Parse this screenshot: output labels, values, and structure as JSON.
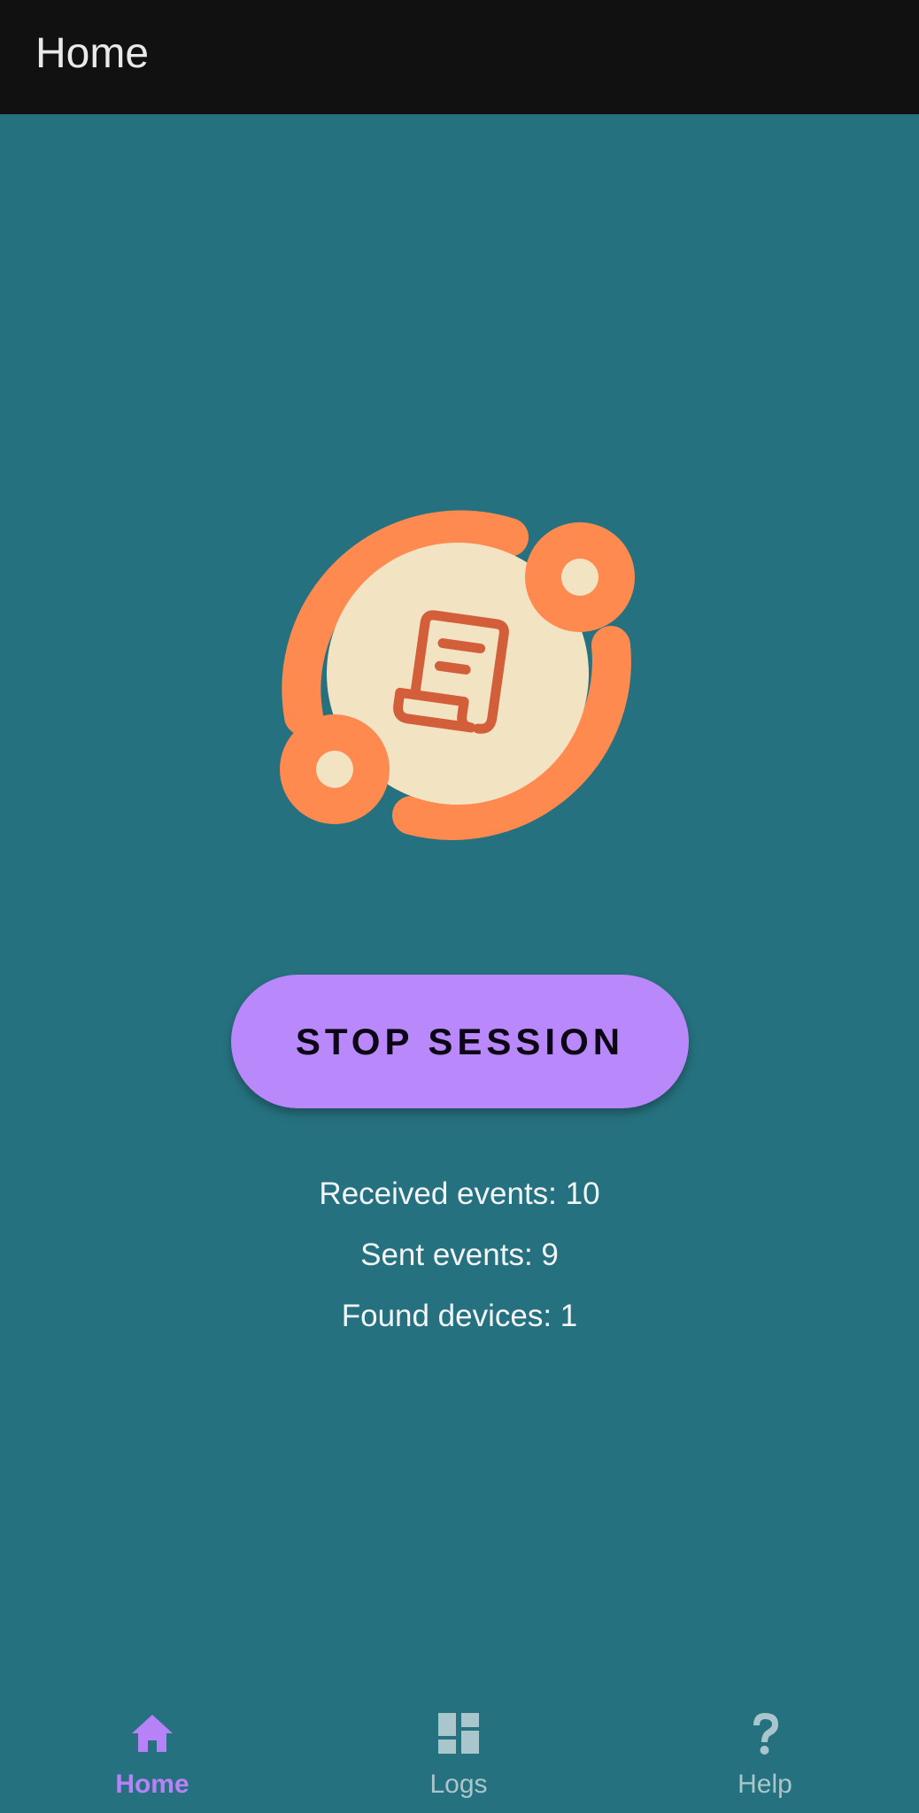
{
  "app_bar": {
    "title": "Home"
  },
  "main": {
    "logo_icon": "scroll-sync-logo",
    "stop_button_label": "STOP SESSION",
    "stats": {
      "received": "Received events: 10",
      "sent": "Sent events: 9",
      "found": "Found devices: 1"
    }
  },
  "bottom_nav": {
    "items": [
      {
        "label": "Home",
        "icon": "home-icon",
        "active": true
      },
      {
        "label": "Logs",
        "icon": "dashboard-icon",
        "active": false
      },
      {
        "label": "Help",
        "icon": "question-mark-icon",
        "active": false
      }
    ]
  },
  "colors": {
    "background": "#26717f",
    "app_bar": "#111111",
    "accent": "#b988fb",
    "logo_orange": "#ff8a50",
    "logo_cream": "#f2e3c3",
    "logo_glyph": "#d25f3a",
    "nav_inactive": "#a9c6cc"
  }
}
